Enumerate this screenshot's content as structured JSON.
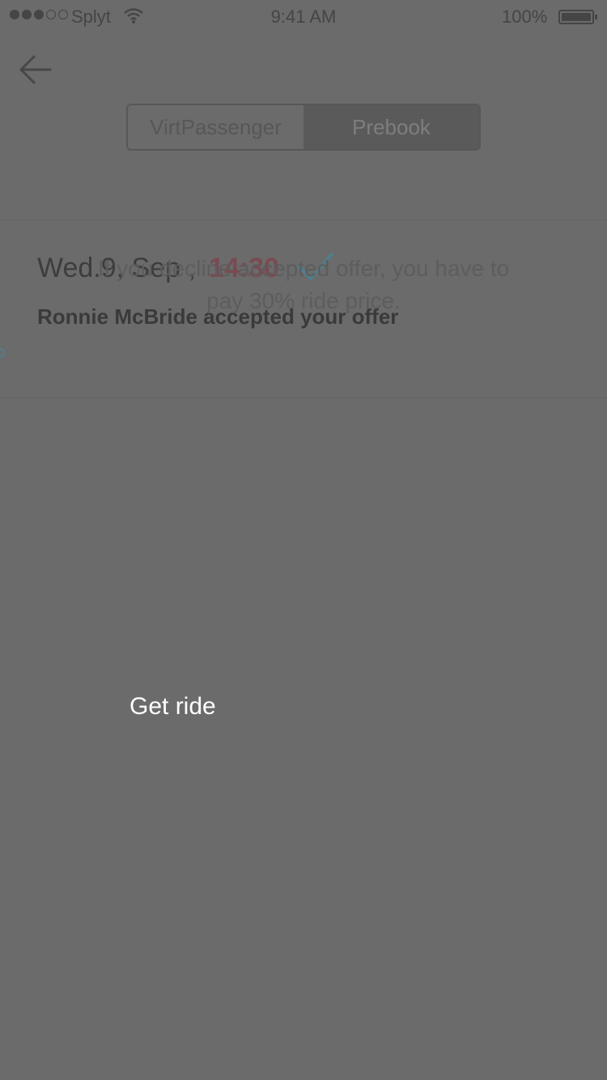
{
  "status_bar": {
    "carrier": "Splyt",
    "time": "9:41 AM",
    "battery": "100%"
  },
  "nav": {
    "tabs": [
      {
        "label": "VirtPassenger",
        "active": false
      },
      {
        "label": "Prebook",
        "active": true
      }
    ]
  },
  "ride": {
    "date": "Wed.9, Sep ,",
    "time": "14:30",
    "accepted_message": "Ronnie McBride accepted your offer"
  },
  "dialog": {
    "message": "If you decline accepted offer, you have to pay 30% ride price.",
    "action_label": "Get ride"
  },
  "colors": {
    "overlay": "#6b6b6b",
    "accent_time": "#7a4a52",
    "check": "#4f7f8e"
  },
  "icons": [
    "back-arrow-icon",
    "wifi-icon",
    "battery-icon",
    "checkmark-icon",
    "signal-icon"
  ]
}
